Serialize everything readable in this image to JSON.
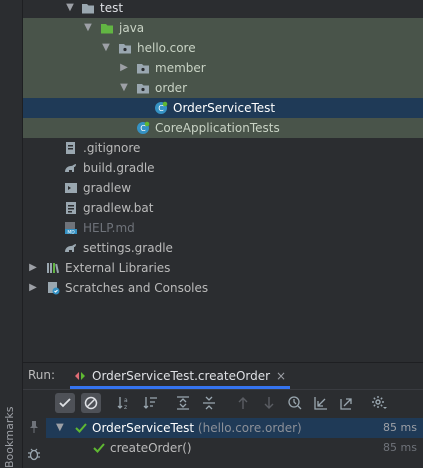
{
  "project_tree": {
    "items": [
      {
        "label": "test",
        "level": 3,
        "expanded": true,
        "icon": "folder-icon"
      },
      {
        "label": "java",
        "level": 4,
        "expanded": true,
        "icon": "source-folder-icon"
      },
      {
        "label": "hello.core",
        "level": 5,
        "expanded": true,
        "icon": "package-icon"
      },
      {
        "label": "member",
        "level": 6,
        "expanded": false,
        "icon": "package-icon"
      },
      {
        "label": "order",
        "level": 6,
        "expanded": true,
        "icon": "package-icon"
      },
      {
        "label": "OrderServiceTest",
        "level": 7,
        "icon": "test-class-icon"
      },
      {
        "label": "CoreApplicationTests",
        "level": 6,
        "icon": "test-class-icon"
      },
      {
        "label": ".gitignore",
        "level": 2,
        "icon": "gitignore-icon"
      },
      {
        "label": "build.gradle",
        "level": 2,
        "icon": "gradle-icon"
      },
      {
        "label": "gradlew",
        "level": 2,
        "icon": "shell-script-icon"
      },
      {
        "label": "gradlew.bat",
        "level": 2,
        "icon": "batch-file-icon"
      },
      {
        "label": "HELP.md",
        "level": 2,
        "icon": "markdown-icon"
      },
      {
        "label": "settings.gradle",
        "level": 2,
        "icon": "gradle-icon"
      },
      {
        "label": "External Libraries",
        "level": 0,
        "expanded": false,
        "icon": "libraries-icon"
      },
      {
        "label": "Scratches and Consoles",
        "level": 0,
        "expanded": false,
        "icon": "scratches-icon"
      }
    ]
  },
  "run_panel": {
    "title": "Run:",
    "tab_label": "OrderServiceTest.createOrder",
    "tab_close": "×"
  },
  "results": {
    "root": {
      "name": "OrderServiceTest",
      "package": "(hello.core.order)",
      "time": "85 ms"
    },
    "child": {
      "name": "createOrder()",
      "time": "85 ms"
    }
  },
  "sidebar": {
    "bookmarks_label": "Bookmarks"
  },
  "colors": {
    "pass_green": "#5fb832",
    "selection": "#1f3a57",
    "highlight": "#49544a",
    "accent": "#3574f0"
  }
}
